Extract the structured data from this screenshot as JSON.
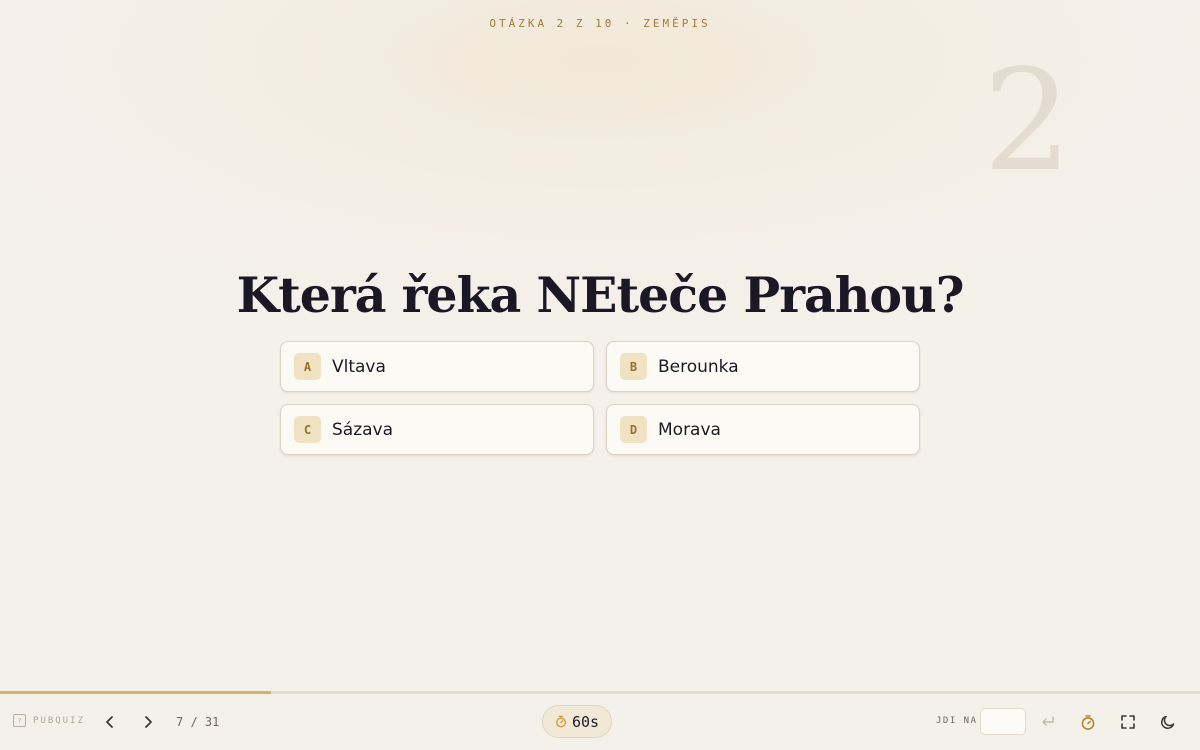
{
  "header": {
    "eyebrow": "OTÁZKA 2 Z 10 · ZEMĚPIS",
    "question_number": "2"
  },
  "question": {
    "text": "Která řeka NEteče Prahou?"
  },
  "answers": [
    {
      "letter": "A",
      "text": "Vltava"
    },
    {
      "letter": "B",
      "text": "Berounka"
    },
    {
      "letter": "C",
      "text": "Sázava"
    },
    {
      "letter": "D",
      "text": "Morava"
    }
  ],
  "progress": {
    "fraction": 0.226
  },
  "toolbar": {
    "brand_label": "PUBQUIZ",
    "brand_icon_glyph": "?",
    "counter": "7 / 31",
    "timer_label": "60s",
    "goto_label": "JDI NA",
    "goto_value": ""
  },
  "icons": {
    "brand": "help-square-icon",
    "prev": "chevron-left-icon",
    "next": "chevron-right-icon",
    "timer": "stopwatch-icon",
    "goto_submit": "enter-icon",
    "timer_toggle": "stopwatch-icon",
    "fullscreen": "fullscreen-icon",
    "theme": "moon-icon"
  },
  "colors": {
    "accent": "#dcae68",
    "accent_dark": "#a27d3c",
    "letter_badge_bg": "#f1e2c4",
    "question_text": "#1b1826",
    "background": "#f4f0ea"
  }
}
